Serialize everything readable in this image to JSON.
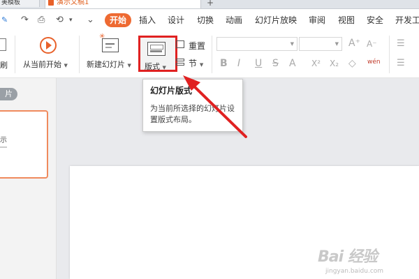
{
  "tabs": {
    "left_tab": "美模板",
    "active_tab": "演示文稿1",
    "add": "+"
  },
  "quick_access": [
    "↷",
    "⎙",
    "⟲",
    "▾",
    "⌄"
  ],
  "menu": {
    "active": "开始",
    "items": [
      "插入",
      "设计",
      "切换",
      "动画",
      "幻灯片放映",
      "审阅",
      "视图",
      "安全",
      "开发工"
    ]
  },
  "ribbon": {
    "format_painter": "刷",
    "from_current": "从当前开始",
    "new_slide": "新建幻灯片",
    "layout": "版式",
    "reset": "重置",
    "section": "节",
    "format_glyphs": [
      "B",
      "I",
      "U",
      "S",
      "A",
      "X²",
      "X₂",
      "◇",
      "wén"
    ]
  },
  "slide_panel": {
    "pill_label": "片",
    "thumb_text": "示"
  },
  "tooltip": {
    "title": "幻灯片版式",
    "body": "为当前所选择的幻灯片设置版式布局。"
  },
  "watermark": {
    "brand": "Bai 经验",
    "site": "jingyan.baidu.com"
  },
  "colors": {
    "accent": "#ee6a32",
    "highlight": "#e02121",
    "arrow": "#e02121"
  }
}
